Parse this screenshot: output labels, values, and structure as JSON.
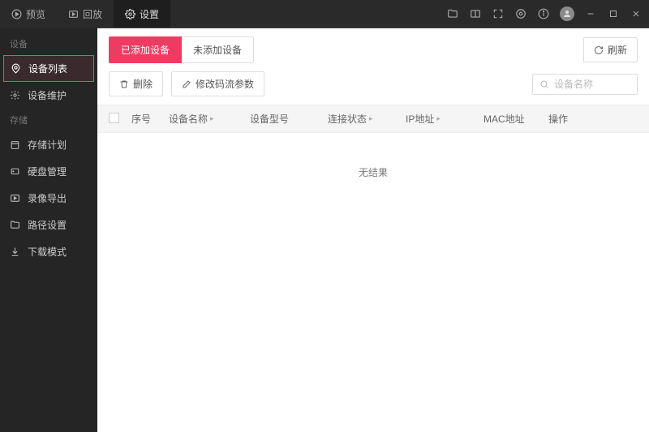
{
  "titlebar": {
    "tabs": [
      {
        "label": "预览"
      },
      {
        "label": "回放"
      },
      {
        "label": "设置"
      }
    ]
  },
  "sidebar": {
    "group1": "设备",
    "items1": [
      {
        "label": "设备列表"
      },
      {
        "label": "设备维护"
      }
    ],
    "group2": "存储",
    "items2": [
      {
        "label": "存储计划"
      },
      {
        "label": "硬盘管理"
      },
      {
        "label": "录像导出"
      },
      {
        "label": "路径设置"
      },
      {
        "label": "下载模式"
      }
    ]
  },
  "main": {
    "sub_tabs": [
      {
        "label": "已添加设备"
      },
      {
        "label": "未添加设备"
      }
    ],
    "refresh": "刷新",
    "delete": "删除",
    "modify": "修改码流参数",
    "search_placeholder": "设备名称",
    "columns": {
      "index": "序号",
      "name": "设备名称",
      "model": "设备型号",
      "status": "连接状态",
      "ip": "IP地址",
      "mac": "MAC地址",
      "op": "操作"
    },
    "empty": "无结果"
  }
}
